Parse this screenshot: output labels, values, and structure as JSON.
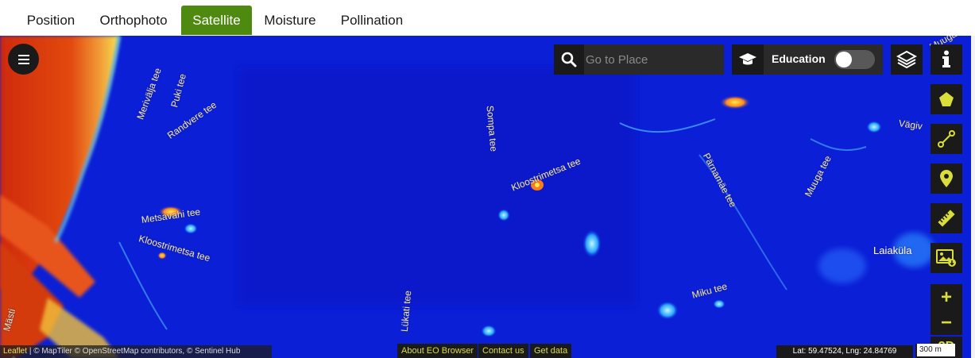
{
  "tabs": [
    {
      "label": "Position",
      "active": false
    },
    {
      "label": "Orthophoto",
      "active": false
    },
    {
      "label": "Satellite",
      "active": true
    },
    {
      "label": "Moisture",
      "active": false
    },
    {
      "label": "Pollination",
      "active": false
    }
  ],
  "colors": {
    "active_tab": "#4f8a10",
    "map_base": "#0a1fd6",
    "dry_area": "#d9330a",
    "control_bg": "#1a1a1a",
    "tool_icon": "#d9de3a"
  },
  "search": {
    "placeholder": "Go to Place",
    "value": ""
  },
  "education": {
    "label": "Education",
    "enabled": false
  },
  "map_labels": {
    "roads": [
      "Merivälja tee",
      "Puki tee",
      "Randvere tee",
      "Metsavahi tee",
      "Kloostrimetsa tee",
      "Kloostrimetsa tee",
      "Sompa tee",
      "Pärnamäe tee",
      "Muuga tee",
      "Lükati tee",
      "Miku tee",
      "Mästi",
      "Vägiv",
      "Muuga"
    ],
    "places": [
      "Laiaküla"
    ]
  },
  "tools": [
    "polygon-icon",
    "line-icon",
    "marker-icon",
    "ruler-icon",
    "image-download-icon"
  ],
  "zoom": {
    "in": "+",
    "out": "−",
    "mode": "3D"
  },
  "attribution": {
    "leaflet": "Leaflet",
    "sep1": "|",
    "rest": "© MapTiler © OpenStreetMap contributors, © Sentinel Hub",
    "maptiler_logo": "maptiler"
  },
  "eo_links": [
    "About EO Browser",
    "Contact us",
    "Get data"
  ],
  "coords": "Lat: 59.47524, Lng: 24.84769",
  "scale": "300 m"
}
